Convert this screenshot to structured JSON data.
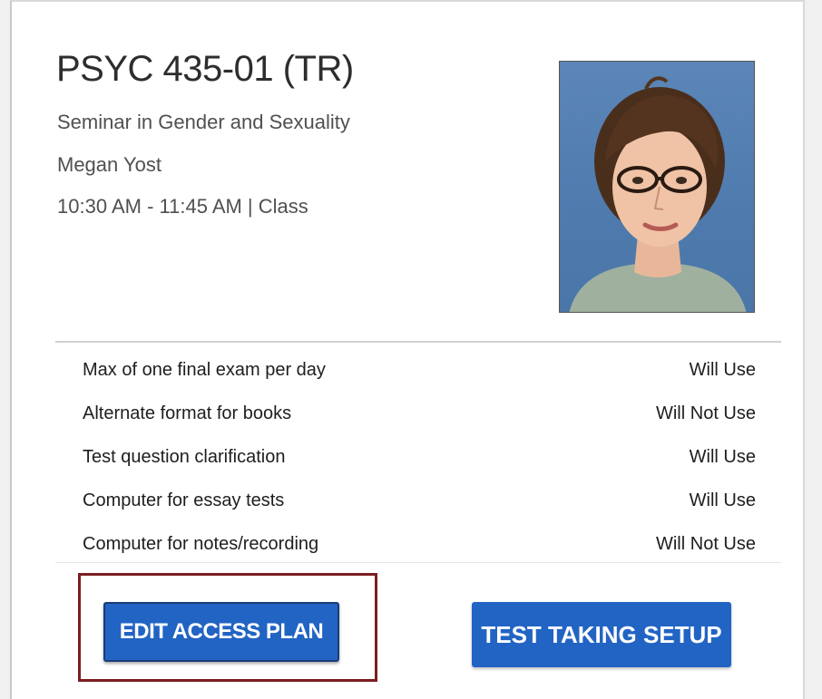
{
  "course": {
    "code": "PSYC 435-01 (TR)",
    "title": "Seminar in Gender and Sexuality",
    "instructor": "Megan Yost",
    "schedule": "10:30 AM - 11:45 AM | Class"
  },
  "accommodations": [
    {
      "name": "Max of one final exam per day",
      "status": "Will Use"
    },
    {
      "name": "Alternate format for books",
      "status": "Will Not Use"
    },
    {
      "name": "Test question clarification",
      "status": "Will Use"
    },
    {
      "name": "Computer for essay tests",
      "status": "Will Use"
    },
    {
      "name": "Computer for notes/recording",
      "status": "Will Not Use"
    }
  ],
  "buttons": {
    "edit_access_plan": "EDIT ACCESS PLAN",
    "test_taking_setup": "TEST TAKING SETUP"
  },
  "colors": {
    "button_blue": "#2264c4",
    "highlight_border": "#7c1d22"
  }
}
